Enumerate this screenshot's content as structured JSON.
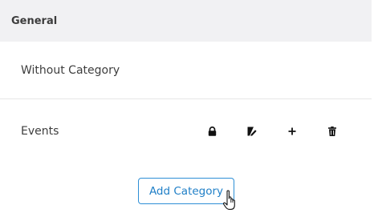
{
  "section": {
    "title": "General"
  },
  "categories": [
    {
      "label": "Without Category",
      "actions": []
    },
    {
      "label": "Events",
      "actions": [
        "lock-icon",
        "edit-icon",
        "plus-icon",
        "trash-icon"
      ]
    }
  ],
  "add_button": {
    "label": "Add Category"
  },
  "colors": {
    "header_bg": "#f1f1f3",
    "accent": "#2e8fd6",
    "divider": "#e6e6e6",
    "text": "#3e3e3e"
  }
}
